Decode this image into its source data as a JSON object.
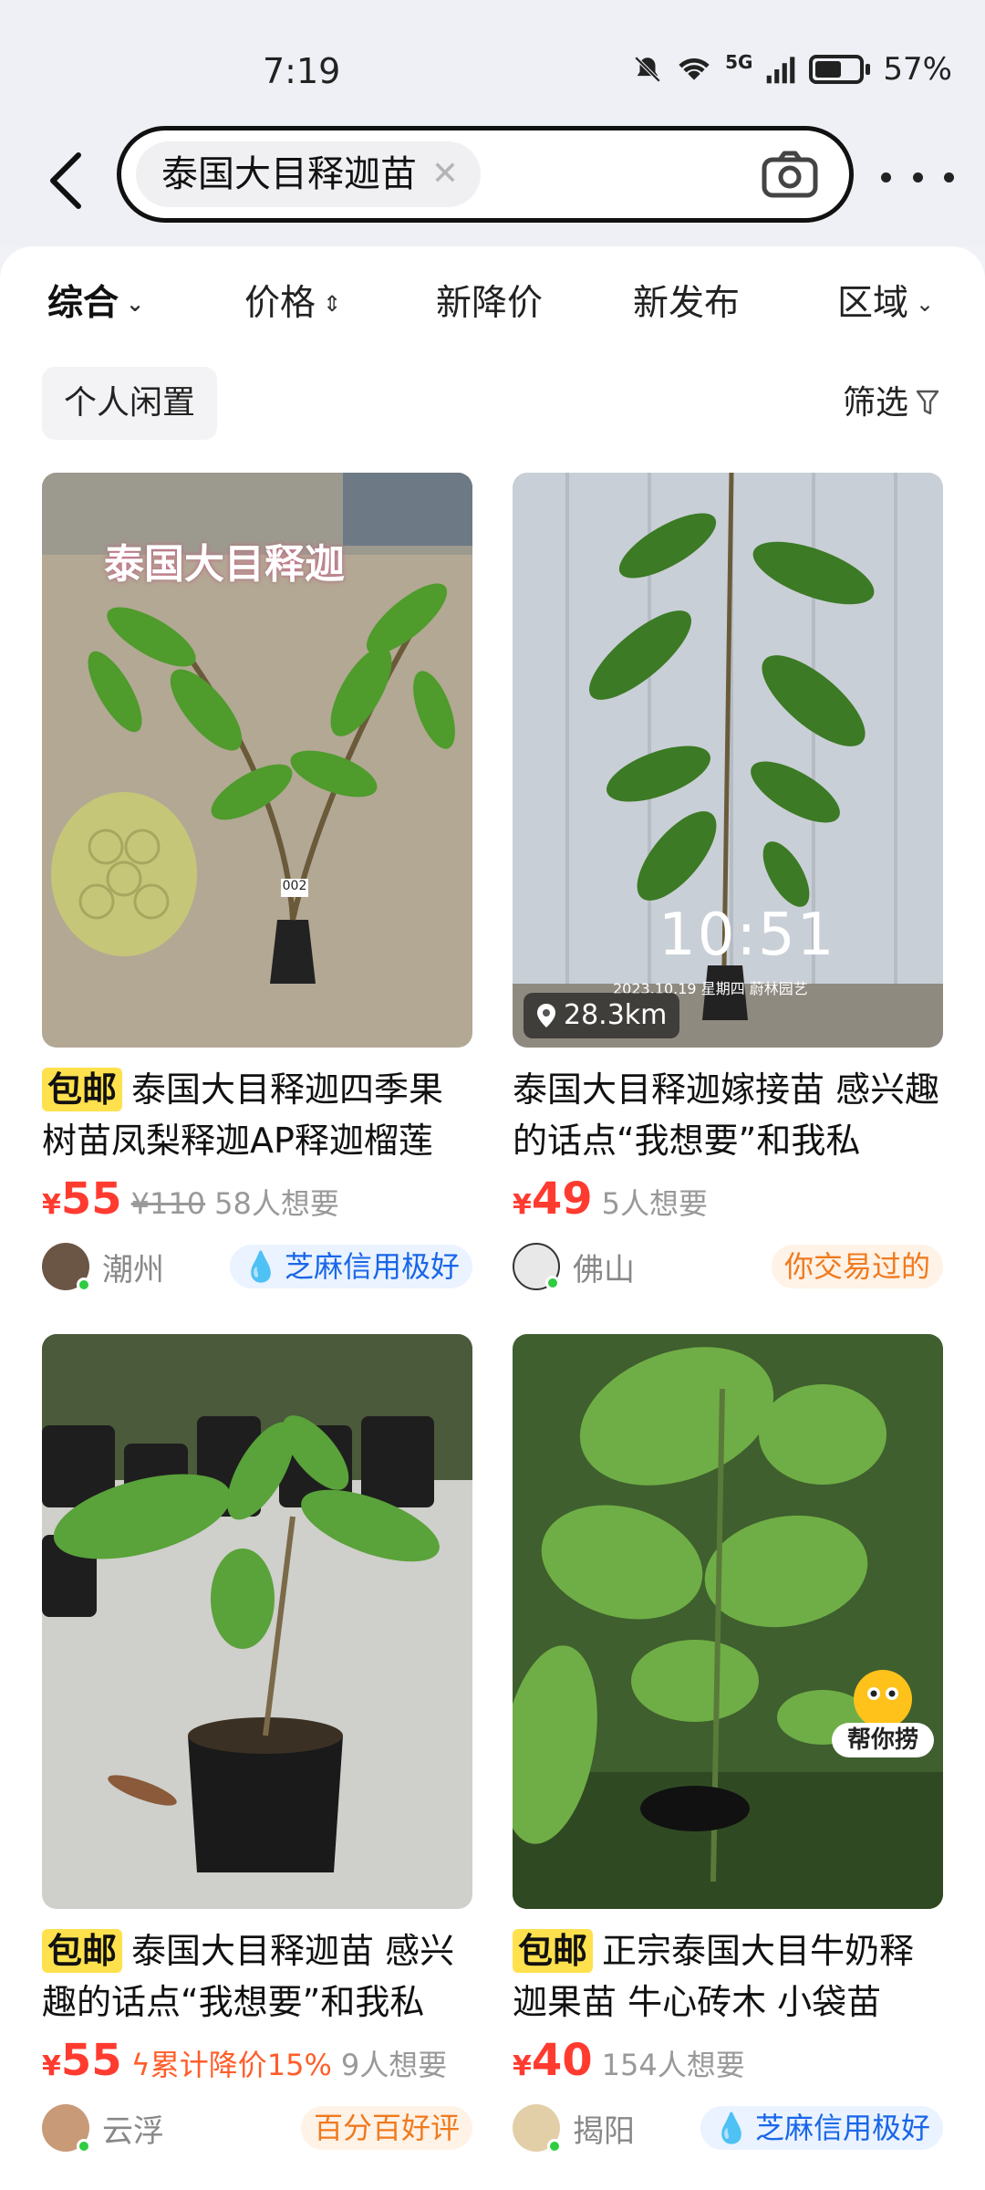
{
  "status_bar": {
    "time": "7:19",
    "network": "5G",
    "battery": "57%"
  },
  "search": {
    "query": "泰国大目释迦苗"
  },
  "filter_tabs": [
    {
      "label": "综合",
      "arrow": "⌄"
    },
    {
      "label": "价格",
      "arrow": "⇕"
    },
    {
      "label": "新降价",
      "arrow": ""
    },
    {
      "label": "新发布",
      "arrow": ""
    },
    {
      "label": "区域",
      "arrow": "⌄"
    }
  ],
  "quick_filter": {
    "label": "个人闲置"
  },
  "filter_button": {
    "label": "筛选"
  },
  "colors": {
    "price": "#ff3b30",
    "free_shipping_tag": "#ffe14d",
    "blue_badge": "#1a66e8",
    "orange_badge": "#f07a1e"
  },
  "products": [
    {
      "tag": "包邮",
      "title": "泰国大目释迦四季果树苗凤梨释迦AP释迦榴莲",
      "currency": "¥",
      "price": "55",
      "original_price": "¥110",
      "wants": "58人想要",
      "location": "潮州",
      "badge": "芝麻信用极好",
      "image_text": "泰国大目释迦",
      "image_label": "002"
    },
    {
      "tag": "",
      "title": "泰国大目释迦嫁接苗 感兴趣的话点“我想要”和我私",
      "currency": "¥",
      "price": "49",
      "wants": "5人想要",
      "location": "佛山",
      "badge": "你交易过的",
      "distance": "28.3km",
      "overlay_time": "10:51",
      "overlay_info": "2023.10.19  星期四  蔚林园艺"
    },
    {
      "tag": "包邮",
      "title": "泰国大目释迦苗 感兴趣的话点“我想要”和我私",
      "currency": "¥",
      "price": "55",
      "price_drop": "累计降价15%",
      "wants": "9人想要",
      "location": "云浮",
      "badge": "百分百好评"
    },
    {
      "tag": "包邮",
      "title": "正宗泰国大目牛奶释迦果苗 牛心砖木 小袋苗",
      "currency": "¥",
      "price": "40",
      "wants": "154人想要",
      "location": "揭阳",
      "badge": "芝麻信用极好",
      "mascot_label": "帮你捞"
    }
  ]
}
